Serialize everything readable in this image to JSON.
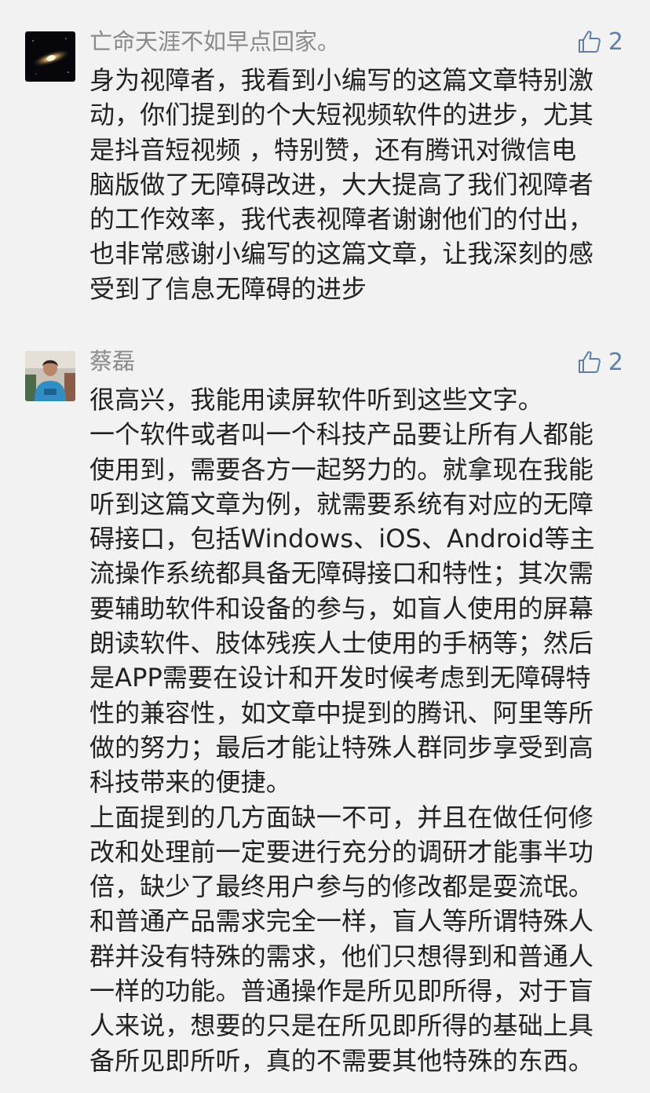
{
  "comments": [
    {
      "author": "亡命天涯不如早点回家。",
      "likes": "2",
      "avatar_icon": "galaxy-avatar",
      "lines": [
        "身为视障者，我看到小编写的这篇文章特别激",
        "动，你们提到的个大短视频软件的进步，尤其",
        "是抖音短视频 ，特别赞，还有腾讯对微信电",
        "脑版做了无障碍改进，大大提高了我们视障者",
        "的工作效率，我代表视障者谢谢他们的付出，",
        "也非常感谢小编写的这篇文章，让我深刻的感",
        "受到了信息无障碍的进步"
      ]
    },
    {
      "author": "蔡磊",
      "likes": "2",
      "avatar_icon": "person-photo-avatar",
      "lines": [
        "很高兴，我能用读屏软件听到这些文字。",
        "一个软件或者叫一个科技产品要让所有人都能",
        "使用到，需要各方一起努力的。就拿现在我能",
        "听到这篇文章为例，就需要系统有对应的无障",
        "碍接口，包括Windows、iOS、Android等主",
        "流操作系统都具备无障碍接口和特性；其次需",
        "要辅助软件和设备的参与，如盲人使用的屏幕",
        "朗读软件、肢体残疾人士使用的手柄等；然后",
        "是APP需要在设计和开发时候考虑到无障碍特",
        "性的兼容性，如文章中提到的腾讯、阿里等所",
        "做的努力；最后才能让特殊人群同步享受到高",
        "科技带来的便捷。",
        "上面提到的几方面缺一不可，并且在做任何修",
        "改和处理前一定要进行充分的调研才能事半功",
        "倍，缺少了最终用户参与的修改都是耍流氓。",
        "和普通产品需求完全一样，盲人等所谓特殊人",
        "群并没有特殊的需求，他们只想得到和普通人",
        "一样的功能。普通操作是所见即所得，对于盲",
        "人来说，想要的只是在所见即所得的基础上具",
        "备所见即所听，真的不需要其他特殊的东西。"
      ]
    }
  ],
  "colors": {
    "background": "#f2f2f2",
    "author": "#8a8a8a",
    "body_text": "#222222",
    "like": "#5f7fa8"
  }
}
